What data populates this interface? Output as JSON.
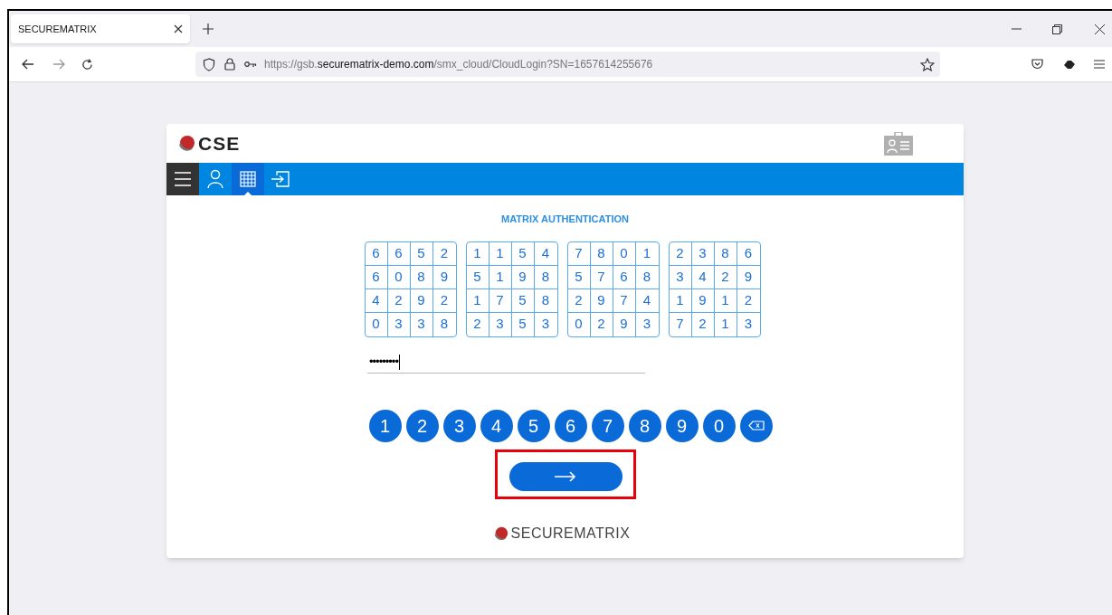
{
  "browser": {
    "tab_title": "SECUREMATRIX",
    "url": {
      "prefix": "https://gsb.",
      "domain": "securematrix-demo.com",
      "path": "/smx_cloud/CloudLogin?SN=1657614255676"
    }
  },
  "header": {
    "logo_text": "CSE"
  },
  "nav": [
    {
      "kind": "menu",
      "selected": false
    },
    {
      "kind": "user",
      "selected": false
    },
    {
      "kind": "matrix",
      "selected": true
    },
    {
      "kind": "login",
      "selected": false
    }
  ],
  "title": "MATRIX AUTHENTICATION",
  "matrices": [
    [
      [
        "6",
        "6",
        "5",
        "2"
      ],
      [
        "6",
        "0",
        "8",
        "9"
      ],
      [
        "4",
        "2",
        "9",
        "2"
      ],
      [
        "0",
        "3",
        "3",
        "8"
      ]
    ],
    [
      [
        "1",
        "1",
        "5",
        "4"
      ],
      [
        "5",
        "1",
        "9",
        "8"
      ],
      [
        "1",
        "7",
        "5",
        "8"
      ],
      [
        "2",
        "3",
        "5",
        "3"
      ]
    ],
    [
      [
        "7",
        "8",
        "0",
        "1"
      ],
      [
        "5",
        "7",
        "6",
        "8"
      ],
      [
        "2",
        "9",
        "7",
        "4"
      ],
      [
        "0",
        "2",
        "9",
        "3"
      ]
    ],
    [
      [
        "2",
        "3",
        "8",
        "6"
      ],
      [
        "3",
        "4",
        "2",
        "9"
      ],
      [
        "1",
        "9",
        "1",
        "2"
      ],
      [
        "7",
        "2",
        "1",
        "3"
      ]
    ]
  ],
  "password": {
    "value": "•••••••••"
  },
  "keypad": [
    "1",
    "2",
    "3",
    "4",
    "5",
    "6",
    "7",
    "8",
    "9",
    "0"
  ],
  "submit": {
    "highlighted": true
  },
  "footer": {
    "logo_text": "SECUREMATRIX"
  }
}
